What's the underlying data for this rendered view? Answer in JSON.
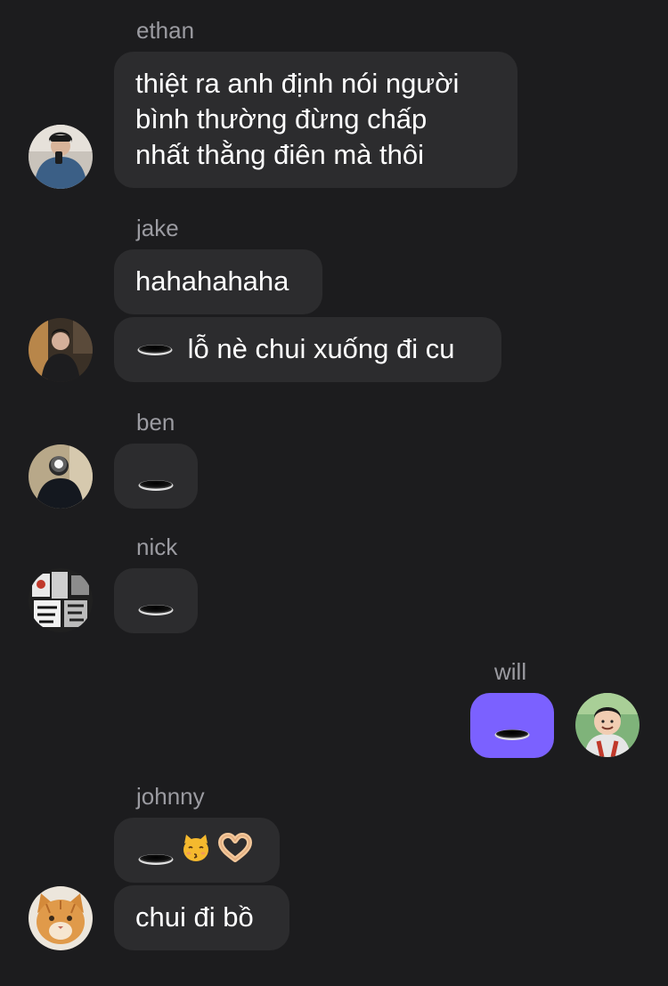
{
  "messages": [
    {
      "sender": "ethan",
      "lines": [
        "thiệt ra anh định nói người",
        "bình thường đừng chấp",
        "nhất thằng điên mà thôi"
      ]
    },
    {
      "sender": "jake",
      "bubbles": [
        {
          "text": "hahahahaha"
        },
        {
          "icon": "hole-emoji",
          "text": "lỗ nè chui xuống đi cu"
        }
      ]
    },
    {
      "sender": "ben",
      "bubbles": [
        {
          "icon": "hole-emoji"
        }
      ]
    },
    {
      "sender": "nick",
      "bubbles": [
        {
          "icon": "hole-emoji"
        }
      ]
    },
    {
      "sender": "will",
      "outgoing": true,
      "bubbles": [
        {
          "icon": "hole-emoji"
        }
      ]
    },
    {
      "sender": "johnny",
      "bubbles": [
        {
          "icons": [
            "hole-emoji",
            "kissing-cat-emoji",
            "heart-hands-emoji"
          ]
        },
        {
          "text": "chui đi bồ"
        }
      ]
    }
  ],
  "colors": {
    "background": "#1c1c1e",
    "bubble_incoming": "#2c2c2e",
    "bubble_outgoing": "#7b61ff",
    "sender_name": "#9b9ba1",
    "text": "#ffffff"
  }
}
